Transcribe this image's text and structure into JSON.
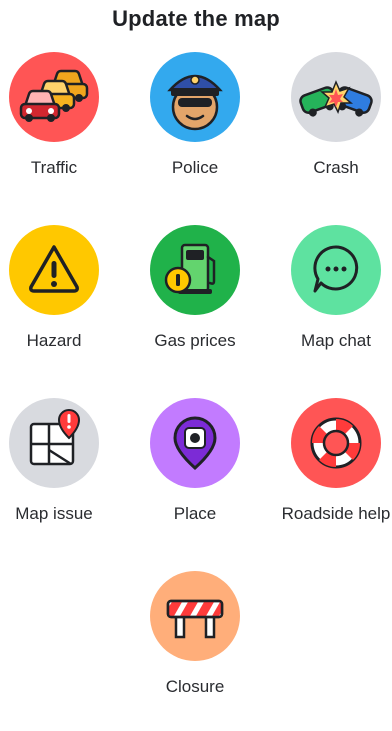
{
  "header": {
    "title": "Update the map"
  },
  "tiles": [
    {
      "id": "traffic",
      "label": "Traffic",
      "icon": "traffic-cars-icon",
      "color": "#ff5555"
    },
    {
      "id": "police",
      "label": "Police",
      "icon": "police-officer-icon",
      "color": "#33a9ee"
    },
    {
      "id": "crash",
      "label": "Crash",
      "icon": "crash-icon",
      "color": "#d8dadf"
    },
    {
      "id": "hazard",
      "label": "Hazard",
      "icon": "hazard-warning-icon",
      "color": "#ffc800"
    },
    {
      "id": "gas",
      "label": "Gas prices",
      "icon": "gas-pump-icon",
      "color": "#20b24a"
    },
    {
      "id": "chat",
      "label": "Map chat",
      "icon": "chat-bubble-icon",
      "color": "#5ee2a0"
    },
    {
      "id": "map-issue",
      "label": "Map issue",
      "icon": "map-issue-icon",
      "color": "#d8dadf"
    },
    {
      "id": "place",
      "label": "Place",
      "icon": "place-pin-icon",
      "color": "#c27bff"
    },
    {
      "id": "roadside",
      "label": "Roadside help",
      "icon": "roadside-lifebuoy-icon",
      "color": "#ff5555"
    },
    {
      "id": "closure",
      "label": "Closure",
      "icon": "road-closure-barrier-icon",
      "color": "#ffae7a"
    }
  ]
}
